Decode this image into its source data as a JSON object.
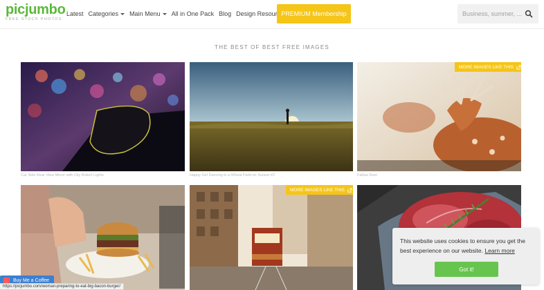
{
  "header": {
    "logo_text": "picjumbo",
    "logo_tagline": "FREE STOCK PHOTOS",
    "nav": [
      {
        "label": "Latest"
      },
      {
        "label": "Categories"
      },
      {
        "label": "Main Menu"
      },
      {
        "label": "All in One Pack"
      },
      {
        "label": "Blog"
      },
      {
        "label": "Design Resources"
      }
    ],
    "premium_label": "PREMIUM Membership",
    "search_placeholder": "Business, summer, ..."
  },
  "section_title": "THE BEST OF BEST FREE IMAGES",
  "photos": [
    {
      "caption": "Car Side Rear View Mirror with City Bokeh Lights",
      "badge": ""
    },
    {
      "caption": "Happy Girl Dancing in a Wheat Field on Sunset #2",
      "badge": ""
    },
    {
      "caption": "Fallow Deer",
      "badge": "MORE IMAGES LIKE THIS"
    },
    {
      "caption": "",
      "badge": ""
    },
    {
      "caption": "",
      "badge": "MORE IMAGES LIKE THIS"
    },
    {
      "caption": "",
      "badge": ""
    }
  ],
  "buy_coffee_label": "Buy Me a Coffee",
  "status_url": "https://picjumbo.com/woman-preparing-to-eat-big-bacon-burger/",
  "cookie": {
    "text": "This website uses cookies to ensure you get the best experience on our website.",
    "link_label": "Learn more",
    "button_label": "Got it!"
  },
  "colors": {
    "brand_green": "#5bb83a",
    "premium_yellow": "#f5c518",
    "cookie_button_green": "#67c44f",
    "coffee_blue": "#3d7fd1"
  }
}
